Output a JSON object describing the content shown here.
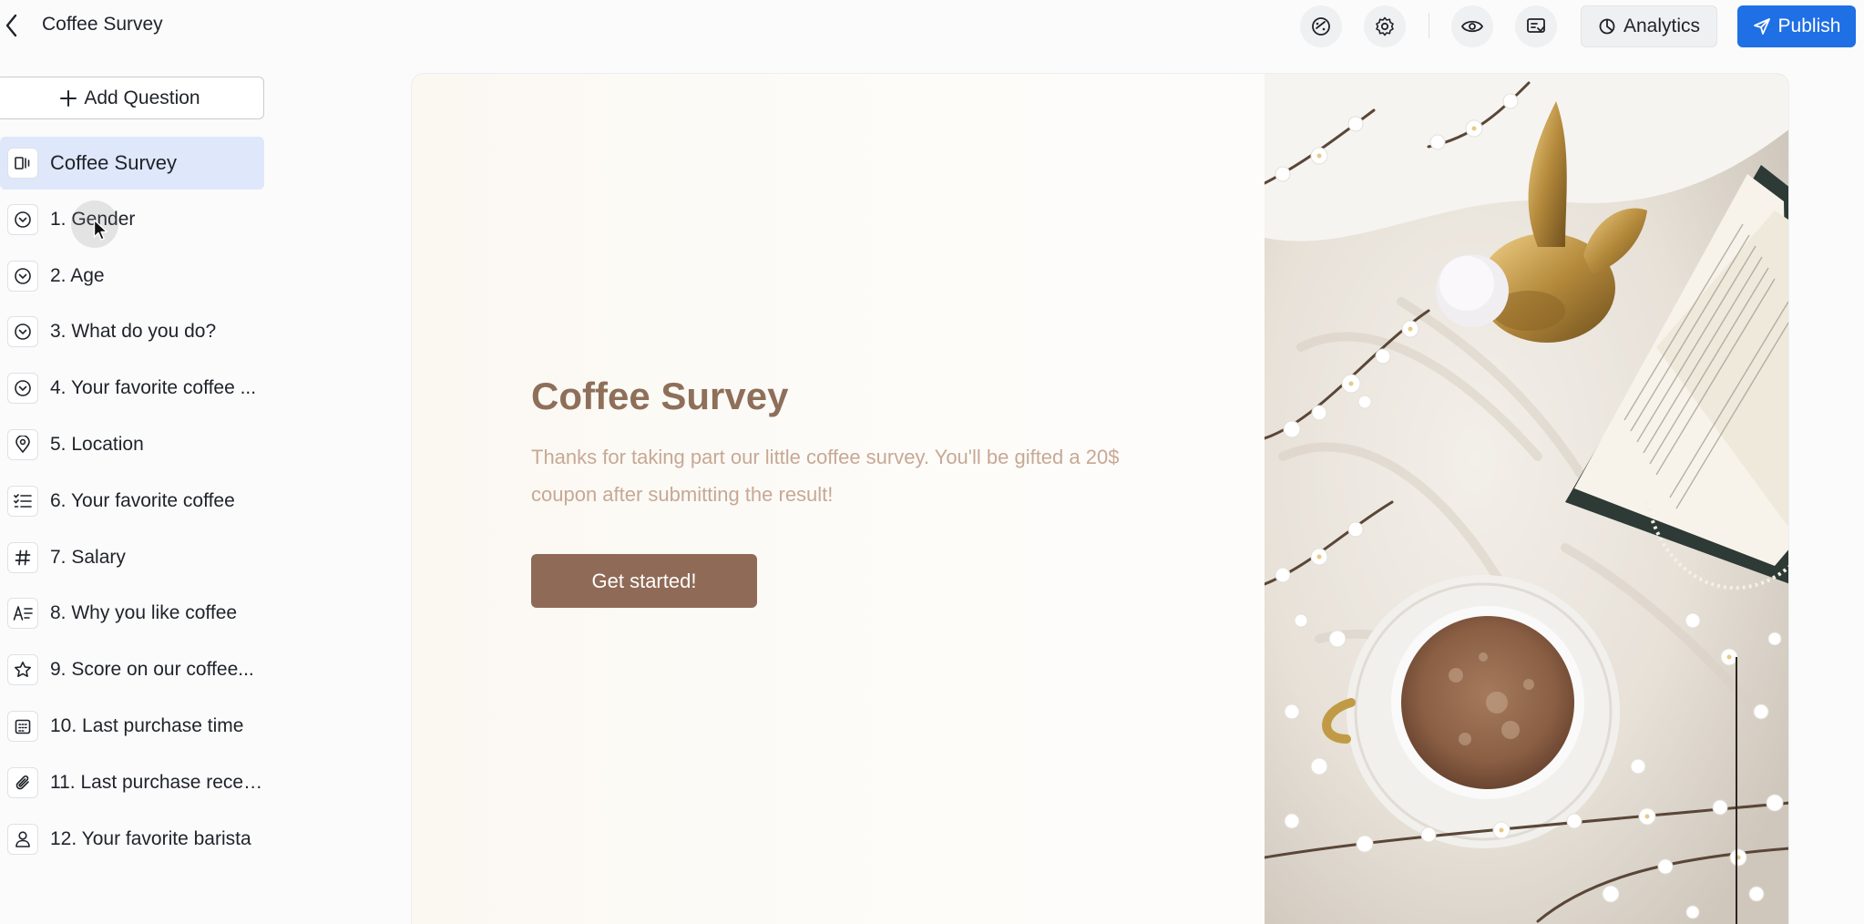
{
  "header": {
    "title": "Coffee Survey",
    "analytics_label": "Analytics",
    "publish_label": "Publish"
  },
  "sidebar": {
    "add_question_label": "Add Question",
    "items": [
      {
        "label": "Coffee Survey",
        "icon": "cover-icon",
        "active": true
      },
      {
        "label": "1. Gender",
        "icon": "dropdown-icon"
      },
      {
        "label": "2. Age",
        "icon": "dropdown-icon"
      },
      {
        "label": "3. What do you do?",
        "icon": "dropdown-icon"
      },
      {
        "label": "4. Your favorite coffee ...",
        "icon": "dropdown-icon"
      },
      {
        "label": "5. Location",
        "icon": "location-icon"
      },
      {
        "label": "6. Your favorite coffee",
        "icon": "checklist-icon"
      },
      {
        "label": "7. Salary",
        "icon": "number-icon"
      },
      {
        "label": "8. Why you like coffee",
        "icon": "text-icon"
      },
      {
        "label": "9. Score on our coffee...",
        "icon": "star-icon"
      },
      {
        "label": "10. Last purchase time",
        "icon": "calendar-icon"
      },
      {
        "label": "11. Last purchase recei...",
        "icon": "attachment-icon"
      },
      {
        "label": "12. Your favorite barista",
        "icon": "person-icon"
      }
    ]
  },
  "cover": {
    "title": "Coffee Survey",
    "description": "Thanks for taking part our little coffee survey. You'll be gifted a 20$ coupon after submitting the result!",
    "button_label": "Get started!"
  },
  "colors": {
    "accent": "#1f6fe5",
    "cover_title": "#8e6f5a",
    "cover_desc": "#c7a895",
    "start_button": "#8f6a56"
  }
}
